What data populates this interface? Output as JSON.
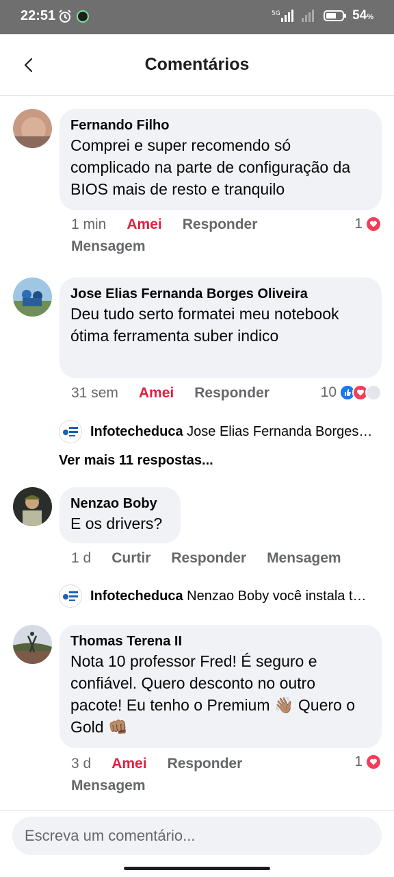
{
  "status_bar": {
    "time": "22:51",
    "network": "5G",
    "battery": "54",
    "battery_unit": "%"
  },
  "header": {
    "title": "Comentários"
  },
  "comments": [
    {
      "author": "Fernando Filho",
      "text": "Comprei e super recomendo só complicado na parte de configuração da BIOS mais de resto e tranquilo",
      "time": "1 min",
      "reaction_label": "Amei",
      "reply_label": "Responder",
      "message_label": "Mensagem",
      "reaction_count": "1",
      "reaction_icons": [
        "heart-icon"
      ]
    },
    {
      "author": "Jose Elias Fernanda Borges Oliveira",
      "text": "Deu tudo serto formatei meu notebook ótima ferramenta suber indico",
      "time": "31 sem",
      "reaction_label": "Amei",
      "reply_label": "Responder",
      "reaction_count": "10",
      "reaction_icons": [
        "like-icon",
        "heart-icon"
      ],
      "reply": {
        "author": "Infotecheduca",
        "text": "Jose Elias Fernanda Borges…"
      },
      "more_replies": "Ver mais 11 respostas..."
    },
    {
      "author": "Nenzao Boby",
      "text": "E os drivers?",
      "time": "1 d",
      "reaction_label": "Curtir",
      "reply_label": "Responder",
      "message_label": "Mensagem",
      "reply": {
        "author": "Infotecheduca",
        "text": "Nenzao Boby você instala t…"
      }
    },
    {
      "author": "Thomas Terena II",
      "text": "Nota 10 professor Fred! É seguro e confiável. Quero desconto no outro pacote! Eu tenho o Premium 👋🏽 Quero o Gold 👊🏽",
      "time": "3 d",
      "reaction_label": "Amei",
      "reply_label": "Responder",
      "message_label": "Mensagem",
      "reaction_count": "1",
      "reaction_icons": [
        "heart-icon"
      ]
    }
  ],
  "input": {
    "placeholder": "Escreva um comentário..."
  },
  "colors": {
    "loved": "#e41e3f",
    "bubble": "#f0f2f5",
    "secondary_text": "#65676b"
  }
}
